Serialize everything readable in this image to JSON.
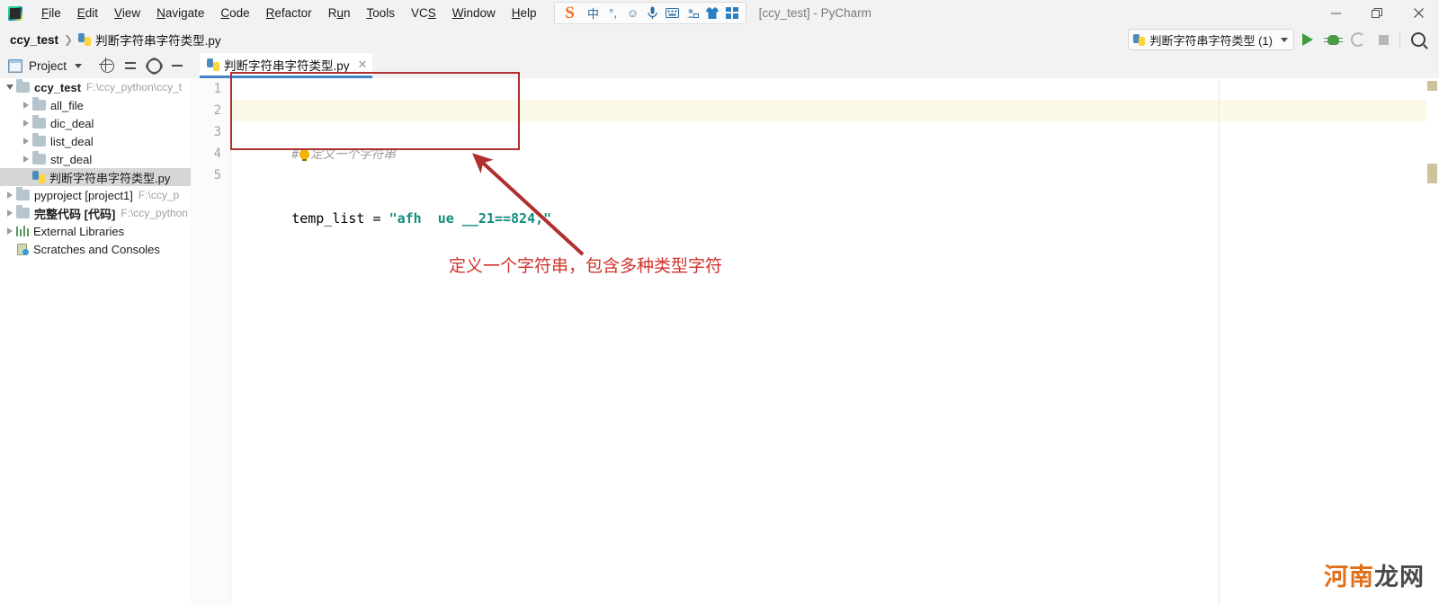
{
  "window": {
    "title": "[ccy_test] - PyCharm",
    "minimize_label": "–",
    "restore_label": "❐",
    "close_label": "✕"
  },
  "menu": {
    "items": [
      {
        "label": "File",
        "mnemonic": "F"
      },
      {
        "label": "Edit",
        "mnemonic": "E"
      },
      {
        "label": "View",
        "mnemonic": "V"
      },
      {
        "label": "Navigate",
        "mnemonic": "N"
      },
      {
        "label": "Code",
        "mnemonic": "C"
      },
      {
        "label": "Refactor",
        "mnemonic": "R"
      },
      {
        "label": "Run",
        "mnemonic": "u"
      },
      {
        "label": "Tools",
        "mnemonic": "T"
      },
      {
        "label": "VCS",
        "mnemonic": "S"
      },
      {
        "label": "Window",
        "mnemonic": "W"
      },
      {
        "label": "Help",
        "mnemonic": "H"
      }
    ]
  },
  "ime_toolbar": {
    "logo": "S",
    "buttons": [
      {
        "name": "chinese-mode-icon",
        "glyph": "中"
      },
      {
        "name": "punctuation-icon",
        "glyph": "°,"
      },
      {
        "name": "emoji-icon",
        "glyph": "☺"
      },
      {
        "name": "voice-input-icon",
        "glyph": "Ψ"
      },
      {
        "name": "soft-keyboard-icon",
        "glyph": "⌨"
      },
      {
        "name": "handwriting-icon",
        "glyph": "✎"
      },
      {
        "name": "skin-icon",
        "glyph": "▼"
      },
      {
        "name": "toolbox-icon",
        "glyph": "∷"
      }
    ]
  },
  "breadcrumb": {
    "root": "ccy_test",
    "separator": "❯",
    "file": "判断字符串字符类型.py"
  },
  "run_toolbar": {
    "configuration": "判断字符串字符类型 (1)",
    "run_tooltip": "Run",
    "debug_tooltip": "Debug",
    "coverage_tooltip": "Run with Coverage",
    "stop_tooltip": "Stop",
    "search_tooltip": "Search Everywhere"
  },
  "project_panel": {
    "title": "Project",
    "tree": [
      {
        "label": "ccy_test",
        "path": "F:\\ccy_python\\ccy_t",
        "depth": 0,
        "bold": true,
        "expanded": true,
        "icon": "folder",
        "selected": false
      },
      {
        "label": "all_file",
        "path": "",
        "depth": 1,
        "bold": false,
        "expanded": false,
        "icon": "folder",
        "selected": false
      },
      {
        "label": "dic_deal",
        "path": "",
        "depth": 1,
        "bold": false,
        "expanded": false,
        "icon": "folder",
        "selected": false
      },
      {
        "label": "list_deal",
        "path": "",
        "depth": 1,
        "bold": false,
        "expanded": false,
        "icon": "folder",
        "selected": false
      },
      {
        "label": "str_deal",
        "path": "",
        "depth": 1,
        "bold": false,
        "expanded": false,
        "icon": "folder",
        "selected": false
      },
      {
        "label": "判断字符串字符类型.py",
        "path": "",
        "depth": 1,
        "bold": false,
        "expanded": null,
        "icon": "python",
        "selected": true
      },
      {
        "label": "pyproject [project1]",
        "path": "F:\\ccy_p",
        "depth": 0,
        "bold": false,
        "expanded": false,
        "icon": "folder",
        "selected": false
      },
      {
        "label": "完整代码 [代码]",
        "path": "F:\\ccy_python",
        "depth": 0,
        "bold": true,
        "expanded": false,
        "icon": "folder",
        "selected": false
      },
      {
        "label": "External Libraries",
        "path": "",
        "depth": 0,
        "bold": false,
        "expanded": false,
        "icon": "library",
        "selected": false
      },
      {
        "label": "Scratches and Consoles",
        "path": "",
        "depth": 0,
        "bold": false,
        "expanded": null,
        "icon": "scratch",
        "selected": false
      }
    ]
  },
  "editor": {
    "tab": {
      "label": "判断字符串字符类型.py",
      "close": "✕"
    },
    "line_numbers": [
      "1",
      "2",
      "3",
      "4",
      "5"
    ],
    "highlighted_line": 2,
    "lines": [
      {
        "n": 1,
        "tokens": [
          {
            "type": "comment",
            "text": "#"
          },
          {
            "type": "bulb",
            "text": ""
          },
          {
            "type": "comment",
            "text": "定义一个字符串"
          }
        ]
      },
      {
        "n": 2,
        "tokens": [
          {
            "type": "var",
            "text": "temp_list"
          },
          {
            "type": "op",
            "text": " = "
          },
          {
            "type": "str",
            "text": "\"afh  ue __21==824,\""
          }
        ]
      },
      {
        "n": 3,
        "tokens": []
      },
      {
        "n": 4,
        "tokens": []
      },
      {
        "n": 5,
        "tokens": []
      }
    ]
  },
  "annotations": {
    "box_color": "#b03030",
    "arrow_color": "#b03030",
    "text": "定义一个字符串，包含多种类型字符",
    "text_color": "#d0342c"
  },
  "watermark": {
    "part1": "河南",
    "part2": "龙网",
    "color1": "#e0701b",
    "color2": "#4a4a4a"
  }
}
